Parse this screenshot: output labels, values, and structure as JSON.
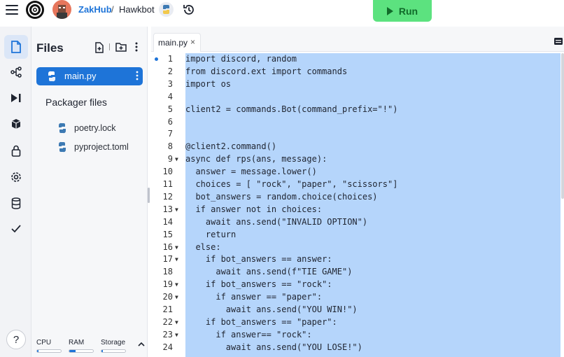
{
  "header": {
    "owner": "ZakHub",
    "separator": "/",
    "repl_name": "Hawkbot",
    "run_label": "Run"
  },
  "sidebar": {
    "items": [
      {
        "name": "files",
        "icon": "file-icon",
        "active": true
      },
      {
        "name": "version-control",
        "icon": "branch-icon"
      },
      {
        "name": "debugger",
        "icon": "step-icon"
      },
      {
        "name": "packages",
        "icon": "cube-icon"
      },
      {
        "name": "secrets",
        "icon": "lock-icon"
      },
      {
        "name": "settings",
        "icon": "gear-icon"
      },
      {
        "name": "database",
        "icon": "database-icon"
      },
      {
        "name": "unit-tests",
        "icon": "check-icon"
      }
    ],
    "help_label": "?"
  },
  "files_panel": {
    "title": "Files",
    "selected_file": "main.py",
    "packager_title": "Packager files",
    "packager_files": [
      "poetry.lock",
      "pyproject.toml"
    ],
    "metrics": {
      "cpu_label": "CPU",
      "cpu_level": 0.02,
      "ram_label": "RAM",
      "ram_level": 0.25,
      "storage_label": "Storage",
      "storage_level": 0.02
    }
  },
  "editor": {
    "tab_label": "main.py",
    "tab_close": "×",
    "lines": [
      {
        "n": "1",
        "text": "import discord, random",
        "dot": true
      },
      {
        "n": "2",
        "text": "from discord.ext import commands"
      },
      {
        "n": "3",
        "text": "import os"
      },
      {
        "n": "4",
        "text": ""
      },
      {
        "n": "5",
        "text": "client2 = commands.Bot(command_prefix=\"!\")"
      },
      {
        "n": "6",
        "text": ""
      },
      {
        "n": "7",
        "text": ""
      },
      {
        "n": "8",
        "text": "@client2.command()"
      },
      {
        "n": "9",
        "text": "async def rps(ans, message):",
        "fold": true
      },
      {
        "n": "10",
        "text": "  answer = message.lower()"
      },
      {
        "n": "11",
        "text": "  choices = [ \"rock\", \"paper\", \"scissors\"]"
      },
      {
        "n": "12",
        "text": "  bot_answers = random.choice(choices)"
      },
      {
        "n": "13",
        "text": "  if answer not in choices:",
        "fold": true
      },
      {
        "n": "14",
        "text": "    await ans.send(\"INVALID OPTION\")"
      },
      {
        "n": "15",
        "text": "    return"
      },
      {
        "n": "16",
        "text": "  else:",
        "fold": true
      },
      {
        "n": "17",
        "text": "    if bot_answers == answer:",
        "fold": true
      },
      {
        "n": "18",
        "text": "      await ans.send(f\"TIE GAME\")"
      },
      {
        "n": "19",
        "text": "    if bot_answers == \"rock\":",
        "fold": true
      },
      {
        "n": "20",
        "text": "      if answer == \"paper\":",
        "fold": true
      },
      {
        "n": "21",
        "text": "        await ans.send(\"YOU WIN!\")"
      },
      {
        "n": "22",
        "text": "    if bot_answers == \"paper\":",
        "fold": true
      },
      {
        "n": "23",
        "text": "      if answer== \"rock\":",
        "fold": true
      },
      {
        "n": "24",
        "text": "        await ans.send(\"YOU LOSE!\")"
      }
    ]
  },
  "colors": {
    "accent": "#1e74d8",
    "run_green": "#5ce27f",
    "selection": "#b5d5fb"
  }
}
